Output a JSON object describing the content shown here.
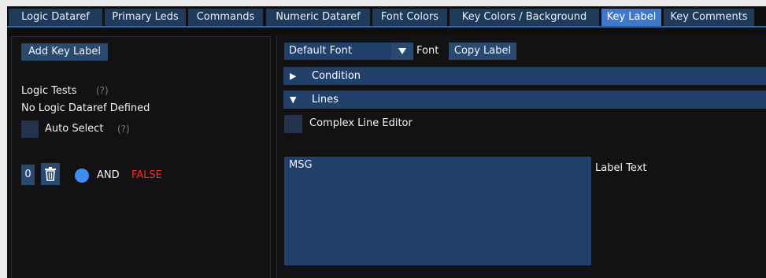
{
  "tabs": [
    {
      "label": "Logic Dataref",
      "active": false
    },
    {
      "label": "Primary Leds",
      "active": false
    },
    {
      "label": "Commands",
      "active": false
    },
    {
      "label": "Numeric Dataref",
      "active": false
    },
    {
      "label": "Font Colors",
      "active": false
    },
    {
      "label": "Key Colors / Background",
      "active": false
    },
    {
      "label": "Key Label",
      "active": true
    },
    {
      "label": "Key Comments",
      "active": false
    }
  ],
  "left": {
    "add_key_label": "Add Key Label",
    "logic_tests_label": "Logic Tests",
    "help_hint": "(?)",
    "no_logic": "No Logic Dataref Defined",
    "auto_select_label": "Auto Select",
    "auto_select_hint": "(?)",
    "index_value": "0",
    "operator": "AND",
    "result": "FALSE"
  },
  "right": {
    "font_select_value": "Default Font",
    "font_label": "Font",
    "copy_label": "Copy Label",
    "condition_header": "Condition",
    "lines_header": "Lines",
    "complex_editor_label": "Complex Line Editor",
    "label_text_value": "MSG",
    "label_text_caption": "Label Text"
  },
  "colors": {
    "active_tab": "#3f78c9",
    "button": "#29496f",
    "false_red": "#ff2a2a",
    "radio_blue": "#3d8ef0"
  }
}
